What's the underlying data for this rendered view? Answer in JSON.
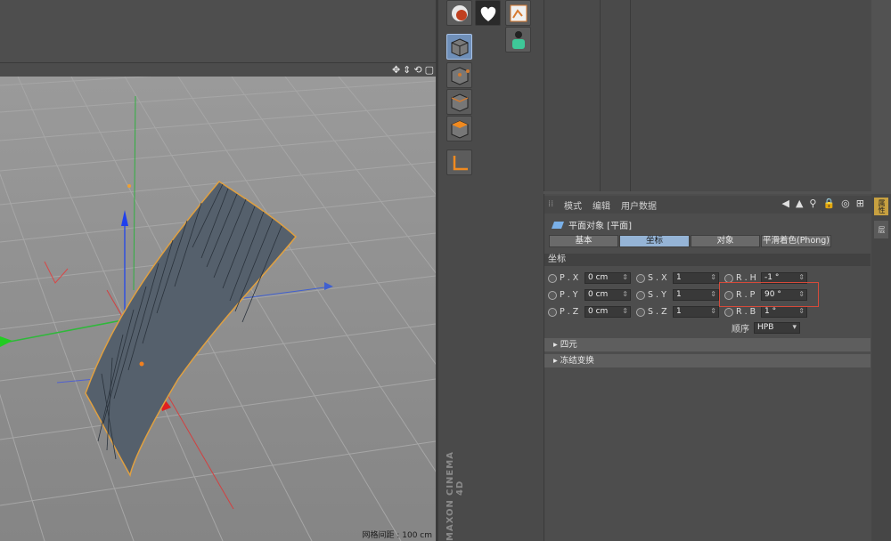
{
  "viewport": {
    "controls": [
      "✥",
      "⇕",
      "⟲",
      "▢"
    ],
    "grid_label": "网格间距 : 100 cm"
  },
  "palette": {
    "tools": [
      {
        "name": "sky-icon",
        "color": "#c04020"
      },
      {
        "name": "heart-icon",
        "color": "#ffffff"
      },
      {
        "name": "image-tag-icon",
        "color": "#d87a30"
      },
      {
        "name": "figure-icon",
        "color": "#3ec898"
      },
      {
        "name": "cube-icon",
        "color": "#7a7a7a"
      },
      {
        "name": "cube-points-icon",
        "color": "#d07a30"
      },
      {
        "name": "cube-edges-icon",
        "color": "#d07a30"
      },
      {
        "name": "cube-faces-icon",
        "color": "#f08a20"
      },
      {
        "name": "axis-icon",
        "color": "#f08a20"
      }
    ],
    "brand_1": "MAXON",
    "brand_2": "CINEMA 4D"
  },
  "attr": {
    "menu": [
      "模式",
      "编辑",
      "用户数据"
    ],
    "tool_icons": [
      "◀",
      "▲",
      "⚲",
      "🔒",
      "◎",
      "⊞"
    ],
    "object_title": "平面对象 [平面]",
    "tabs": [
      "基本",
      "坐标",
      "对象",
      "平滑着色(Phong)"
    ],
    "active_tab": 1,
    "section": "坐标",
    "rows": [
      [
        {
          "label": "P . X",
          "value": "0 cm"
        },
        {
          "label": "S . X",
          "value": "1"
        },
        {
          "label": "R . H",
          "value": "-1 °"
        }
      ],
      [
        {
          "label": "P . Y",
          "value": "0 cm"
        },
        {
          "label": "S . Y",
          "value": "1"
        },
        {
          "label": "R . P",
          "value": "90 °"
        }
      ],
      [
        {
          "label": "P . Z",
          "value": "0 cm"
        },
        {
          "label": "S . Z",
          "value": "1"
        },
        {
          "label": "R . B",
          "value": "1 °"
        }
      ]
    ],
    "order_label": "顺序",
    "order_value": "HPB",
    "groups": [
      "▸ 四元",
      "▸ 冻结变换"
    ]
  },
  "side_tabs": [
    "属性",
    "层"
  ]
}
